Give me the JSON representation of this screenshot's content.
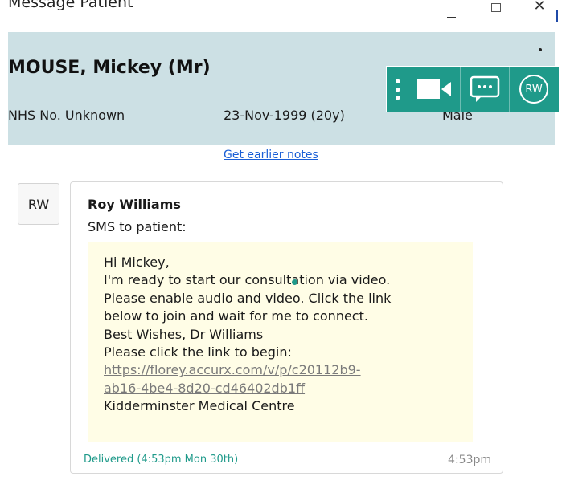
{
  "window": {
    "title": "Message Patient",
    "minimize_icon": "minimize-icon",
    "maximize_icon": "maximize-icon",
    "close_symbol": "✕"
  },
  "patient": {
    "name": "MOUSE, Mickey (Mr)",
    "nhs": "NHS No. Unknown",
    "dob": "23-Nov-1999 (20y)",
    "gender": "Male"
  },
  "action_bar": {
    "color": "#1f9a8a",
    "icons": [
      "more-options-icon",
      "video-camera-icon",
      "chat-bubble-icon"
    ],
    "avatar_initials": "RW"
  },
  "notes": {
    "earlier_link": "Get earlier notes"
  },
  "message": {
    "avatar_initials": "RW",
    "sender": "Roy Williams",
    "channel_label": "SMS to patient:",
    "lines": [
      "Hi Mickey,",
      "I'm ready to start our consultation via video.",
      "Please enable audio and video. Click the link",
      "below to join and wait for me to connect.",
      "Best Wishes, Dr Williams",
      "Please click the link to begin:"
    ],
    "link_lines": [
      "https://florey.accurx.com/v/p/c20112b9-",
      "ab16-4be4-8d20-cd46402db1ff"
    ],
    "footer_line": "Kidderminster Medical Centre",
    "status": "Delivered (4:53pm Mon 30th)",
    "time": "4:53pm"
  },
  "colors": {
    "header_bg": "#cce0e4",
    "bubble_bg": "#fffde6",
    "accent": "#1f9a8a",
    "link": "#1a5fd6"
  }
}
